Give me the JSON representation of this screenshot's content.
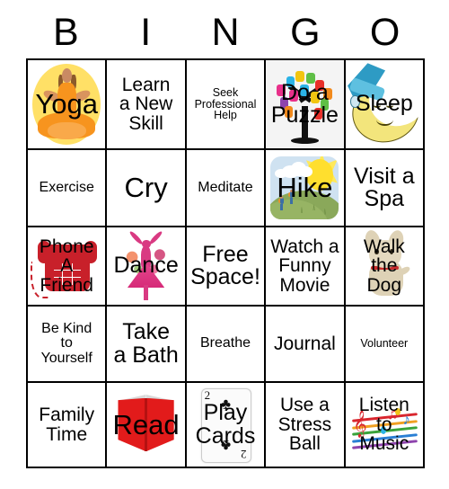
{
  "card": {
    "title": "BINGO",
    "header_letters": [
      "B",
      "I",
      "N",
      "G",
      "O"
    ],
    "free_space_label": "Free Space!",
    "grid_size": "5x5",
    "border_color": "#000000",
    "background_color": "#ffffff"
  },
  "cells": [
    {
      "row": 1,
      "col": 1,
      "text": "Yoga",
      "art": "yoga-illustration",
      "size": "fs-xl",
      "accent": "#ffe066"
    },
    {
      "row": 1,
      "col": 2,
      "text": "Learn\na New\nSkill",
      "art": "none",
      "size": "fs-md",
      "accent": ""
    },
    {
      "row": 1,
      "col": 3,
      "text": "Seek\nProfessional\nHelp",
      "art": "none",
      "size": "fs-xs",
      "accent": ""
    },
    {
      "row": 1,
      "col": 4,
      "text": "Do a\nPuzzle",
      "art": "puzzle-tree-illustration",
      "size": "fs-lg",
      "accent": "#f4f4f4"
    },
    {
      "row": 1,
      "col": 5,
      "text": "Sleep",
      "art": "crescent-moon-illustration",
      "size": "fs-lg",
      "accent": "#f3e57c"
    },
    {
      "row": 2,
      "col": 1,
      "text": "Exercise",
      "art": "none",
      "size": "fs-sm",
      "accent": ""
    },
    {
      "row": 2,
      "col": 2,
      "text": "Cry",
      "art": "none",
      "size": "fs-xl",
      "accent": ""
    },
    {
      "row": 2,
      "col": 3,
      "text": "Meditate",
      "art": "none",
      "size": "fs-sm",
      "accent": ""
    },
    {
      "row": 2,
      "col": 4,
      "text": "Hike",
      "art": "hike-landscape-illustration",
      "size": "fs-xl",
      "accent": "#8aa85a"
    },
    {
      "row": 2,
      "col": 5,
      "text": "Visit a\nSpa",
      "art": "none",
      "size": "fs-lg",
      "accent": ""
    },
    {
      "row": 3,
      "col": 1,
      "text": "Phone\nA\nFriend",
      "art": "red-telephone-illustration",
      "size": "fs-md",
      "accent": "#c8202a"
    },
    {
      "row": 3,
      "col": 2,
      "text": "Dance",
      "art": "dancer-illustration",
      "size": "fs-lg",
      "accent": "#d93a82"
    },
    {
      "row": 3,
      "col": 3,
      "text": "Free\nSpace!",
      "art": "none",
      "size": "fs-lg",
      "accent": ""
    },
    {
      "row": 3,
      "col": 4,
      "text": "Watch a\nFunny\nMovie",
      "art": "none",
      "size": "fs-md",
      "accent": ""
    },
    {
      "row": 3,
      "col": 5,
      "text": "Walk\nthe\nDog",
      "art": "dog-illustration",
      "size": "fs-md",
      "accent": "#ded2b6"
    },
    {
      "row": 4,
      "col": 1,
      "text": "Be Kind\nto\nYourself",
      "art": "none",
      "size": "fs-sm",
      "accent": ""
    },
    {
      "row": 4,
      "col": 2,
      "text": "Take\na Bath",
      "art": "none",
      "size": "fs-lg",
      "accent": ""
    },
    {
      "row": 4,
      "col": 3,
      "text": "Breathe",
      "art": "none",
      "size": "fs-sm",
      "accent": ""
    },
    {
      "row": 4,
      "col": 4,
      "text": "Journal",
      "art": "none",
      "size": "fs-md",
      "accent": ""
    },
    {
      "row": 4,
      "col": 5,
      "text": "Volunteer",
      "art": "none",
      "size": "fs-xs",
      "accent": ""
    },
    {
      "row": 5,
      "col": 1,
      "text": "Family\nTime",
      "art": "none",
      "size": "fs-md",
      "accent": ""
    },
    {
      "row": 5,
      "col": 2,
      "text": "Read",
      "art": "red-book-illustration",
      "size": "fs-xl",
      "accent": "#e21b1b"
    },
    {
      "row": 5,
      "col": 3,
      "text": "Play\nCards",
      "art": "playing-card-illustration",
      "size": "fs-lg",
      "accent": "#fbfbfb"
    },
    {
      "row": 5,
      "col": 4,
      "text": "Use a\nStress\nBall",
      "art": "none",
      "size": "fs-md",
      "accent": ""
    },
    {
      "row": 5,
      "col": 5,
      "text": "Listen\nto\nMusic",
      "art": "music-notes-illustration",
      "size": "fs-md",
      "accent": "#d9262e"
    }
  ]
}
